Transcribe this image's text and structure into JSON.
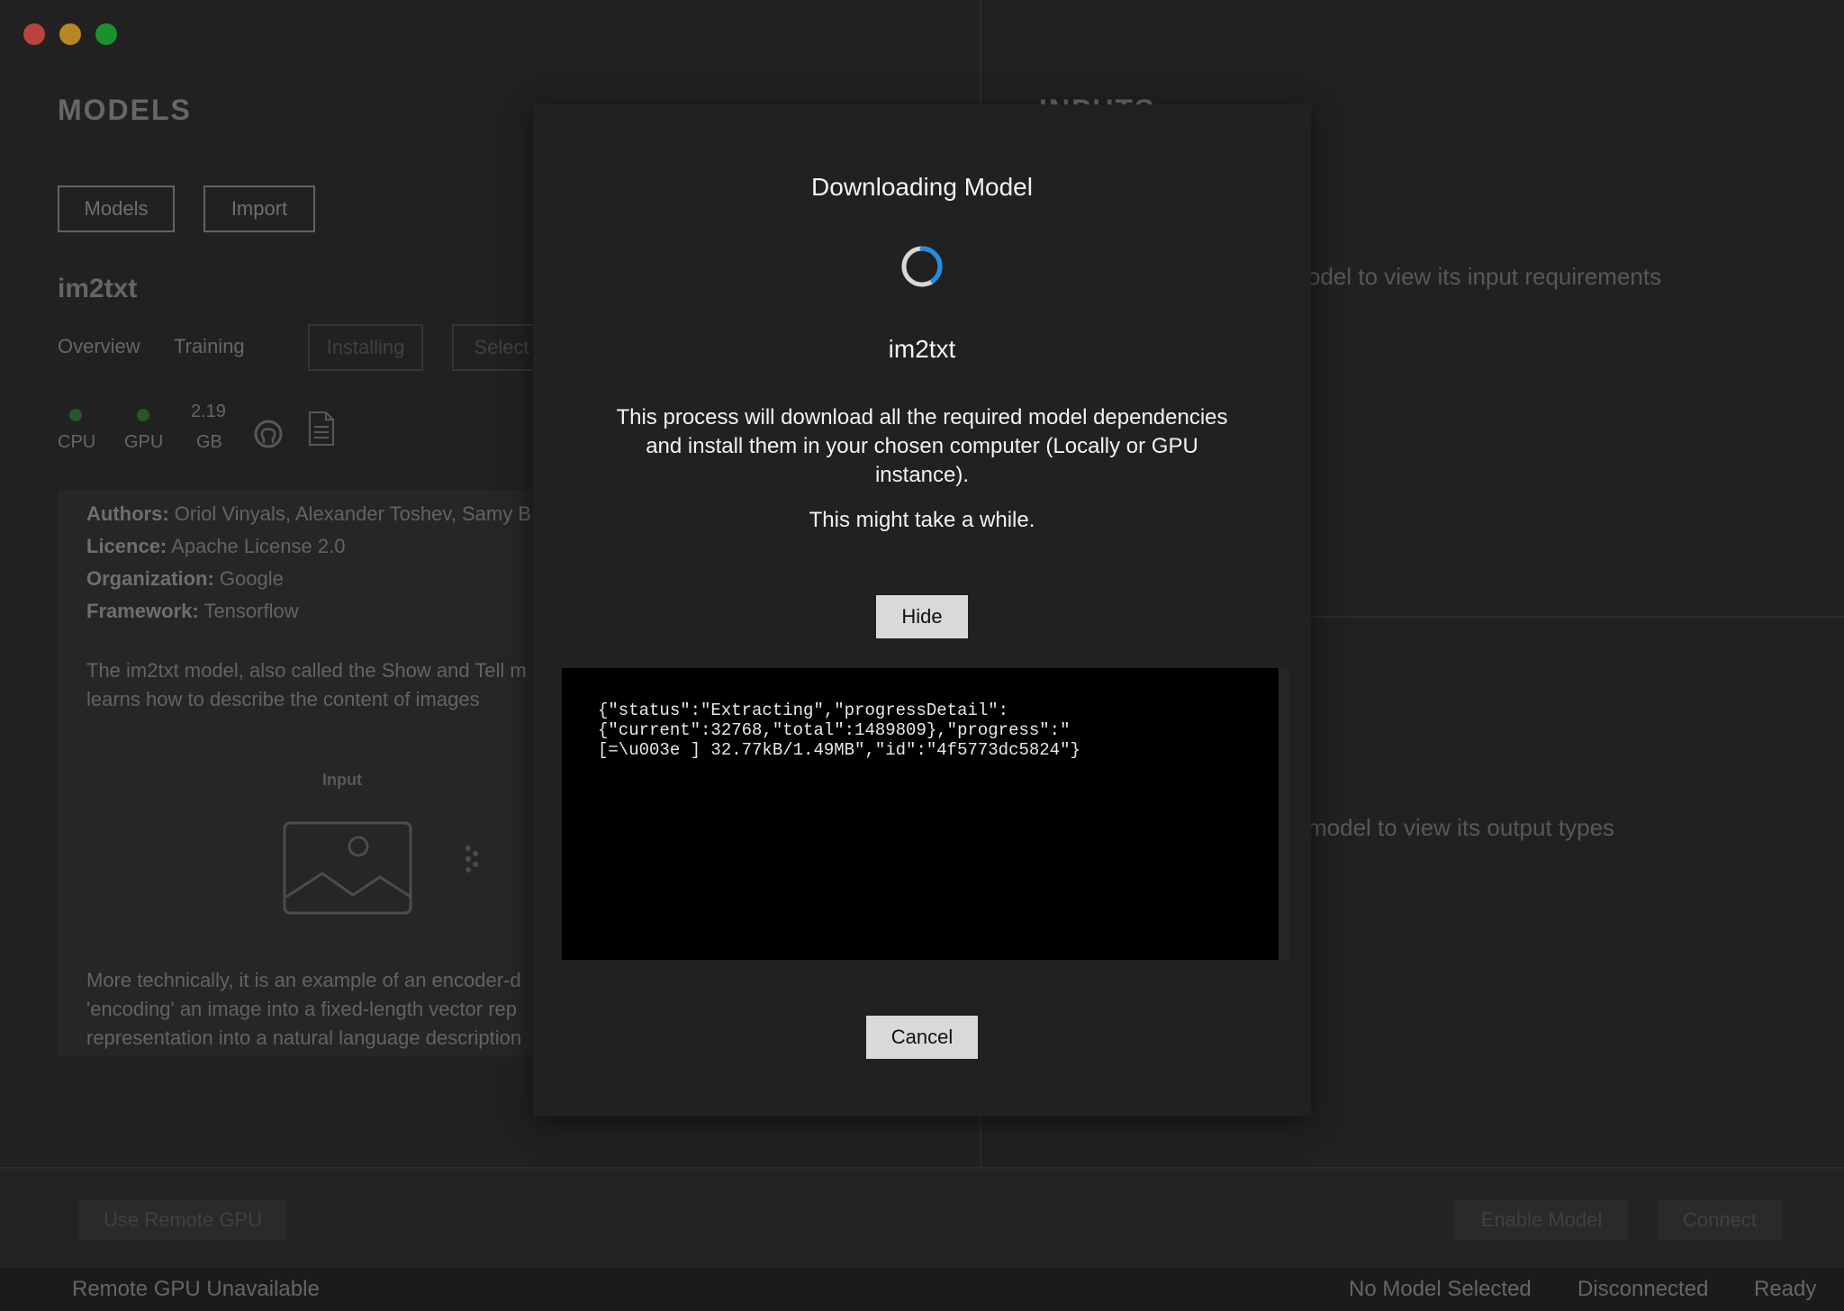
{
  "left": {
    "title": "MODELS",
    "buttons": {
      "models": "Models",
      "import": "Import"
    },
    "model_name": "im2txt",
    "tabs": {
      "overview": "Overview",
      "training": "Training"
    },
    "actions": {
      "installing": "Installing",
      "select": "Select"
    },
    "stats": {
      "cpu": "CPU",
      "gpu": "GPU",
      "size_value": "2.19",
      "size_unit": "GB"
    },
    "meta": {
      "authors_label": "Authors:",
      "authors": "Oriol Vinyals, Alexander Toshev, Samy B",
      "licence_label": "Licence:",
      "licence": "Apache License 2.0",
      "organization_label": "Organization:",
      "organization": "Google",
      "framework_label": "Framework:",
      "framework": "Tensorflow"
    },
    "description": {
      "line1": "The im2txt model, also called the Show and Tell m",
      "line2": "learns how to describe the content of images",
      "input_label": "Input",
      "more1": "More technically, it is an example of an encoder-d",
      "more2": "'encoding' an image into a fixed-length vector rep",
      "more3": "representation into a natural language description"
    }
  },
  "right": {
    "inputs_title": "INPUTS",
    "inputs_hint": "odel to view its input requirements",
    "outputs_hint": "model to view its output types"
  },
  "action_bar": {
    "use_remote_gpu": "Use Remote GPU",
    "enable_model": "Enable Model",
    "connect": "Connect"
  },
  "status_bar": {
    "remote_gpu": "Remote GPU Unavailable",
    "model": "No Model Selected",
    "connection": "Disconnected",
    "state": "Ready"
  },
  "modal": {
    "title": "Downloading Model",
    "model": "im2txt",
    "description": "This process will download all the required model dependencies and install them in your chosen computer (Locally or GPU instance).",
    "note": "This might take a while.",
    "hide_label": "Hide",
    "cancel_label": "Cancel",
    "console_text": "{\"status\":\"Extracting\",\"progressDetail\":\n{\"current\":32768,\"total\":1489809},\"progress\":\"\n[=\\u003e ] 32.77kB/1.49MB\",\"id\":\"4f5773dc5824\"}"
  },
  "colors": {
    "spinner_accent": "#1e8ee6",
    "panel": "#212121"
  }
}
